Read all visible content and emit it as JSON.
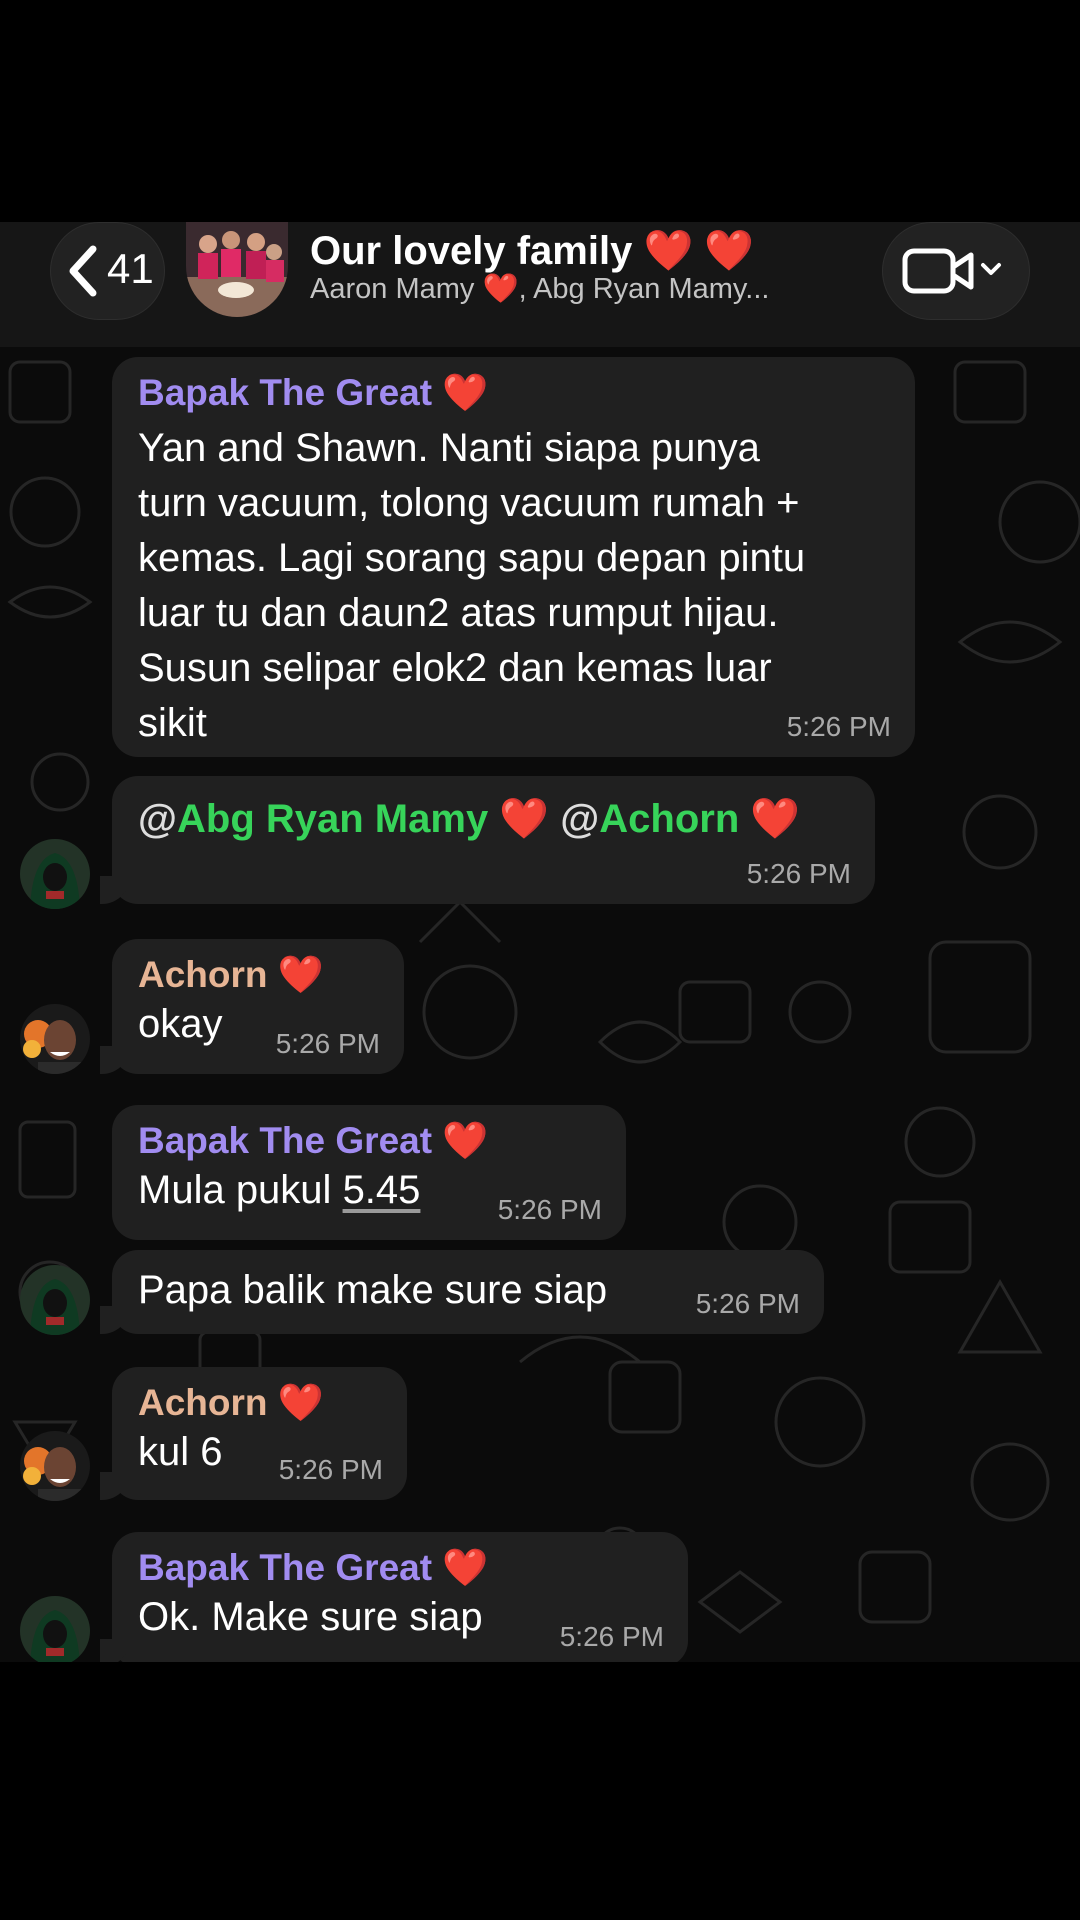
{
  "header": {
    "back_count": "41",
    "title": "Our lovely family",
    "title_hearts": "❤️ ❤️",
    "subtitle_part1": "Aaron Mamy",
    "subtitle_heart": "❤️",
    "subtitle_part2": ", Abg Ryan Mamy..."
  },
  "icons": {
    "back": "chevron-left-icon",
    "video": "video-camera-icon",
    "dropdown": "chevron-down-icon",
    "heart": "red-heart-emoji"
  },
  "colors": {
    "background": "#0b0b0b",
    "bubble": "#202020",
    "sender_bapak": "#a18cf0",
    "sender_achorn": "#e7b595",
    "mention": "#37d45a",
    "heart": "#f0212e"
  },
  "messages": [
    {
      "sender": "Bapak The Great",
      "sender_heart": "❤️",
      "lines": [
        "Yan and Shawn. Nanti siapa punya",
        "turn vacuum, tolong vacuum rumah +",
        "kemas. Lagi sorang sapu depan pintu",
        "luar tu dan daun2 atas rumput hijau.",
        "Susun selipar elok2 dan kemas luar",
        "sikit"
      ],
      "time": "5:26 PM"
    },
    {
      "mention1_at": "@",
      "mention1": "Abg Ryan Mamy",
      "mention1_heart": "❤️",
      "mention2_at": "@",
      "mention2": "Achorn",
      "mention2_heart": "❤️",
      "time": "5:26 PM"
    },
    {
      "sender": "Achorn",
      "sender_heart": "❤️",
      "text": "okay",
      "time": "5:26 PM"
    },
    {
      "sender": "Bapak The Great",
      "sender_heart": "❤️",
      "text_prefix": "Mula pukul ",
      "text_link": "5.45",
      "time": "5:26 PM"
    },
    {
      "text": "Papa balik make sure siap",
      "time": "5:26 PM"
    },
    {
      "sender": "Achorn",
      "sender_heart": "❤️",
      "text": "kul 6",
      "time": "5:26 PM"
    },
    {
      "sender": "Bapak The Great",
      "sender_heart": "❤️",
      "text": "Ok. Make sure siap",
      "time": "5:26 PM"
    }
  ]
}
